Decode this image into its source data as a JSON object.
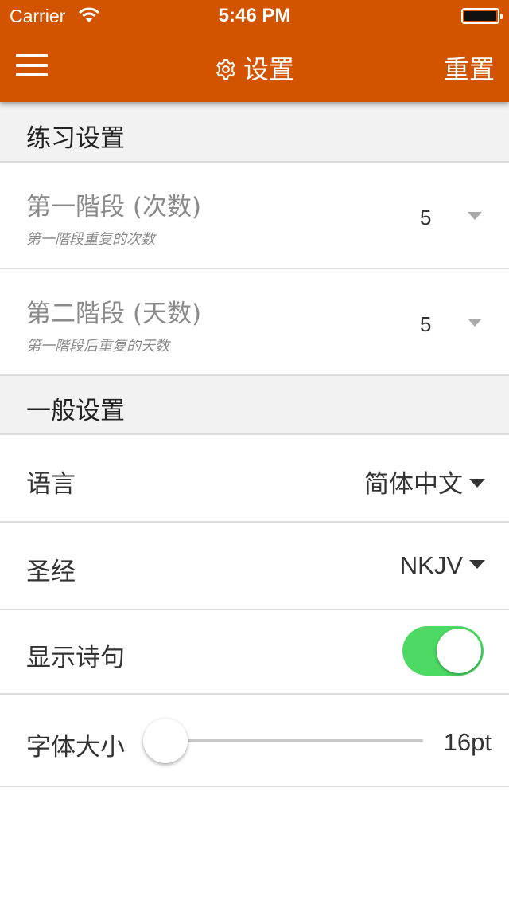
{
  "status_bar": {
    "carrier": "Carrier",
    "time": "5:46 PM"
  },
  "nav": {
    "title": "设置",
    "reset_label": "重置",
    "menu_icon": "menu-icon",
    "title_icon": "gear-icon"
  },
  "colors": {
    "accent": "#d35400",
    "toggle_on": "#4cd964"
  },
  "practice": {
    "header": "练习设置",
    "stage1": {
      "title": "第一階段 (次数)",
      "subtitle": "第一階段重复的次数",
      "value": "5"
    },
    "stage2": {
      "title": "第二階段 (天数)",
      "subtitle": "第一階段后重复的天数",
      "value": "5"
    }
  },
  "general": {
    "header": "一般设置",
    "language": {
      "label": "语言",
      "value": "简体中文"
    },
    "bible": {
      "label": "圣经",
      "value": "NKJV"
    },
    "show_verse": {
      "label": "显示诗句",
      "on": true
    },
    "font_size": {
      "label": "字体大小",
      "value_text": "16pt",
      "fraction": 0.0
    }
  }
}
